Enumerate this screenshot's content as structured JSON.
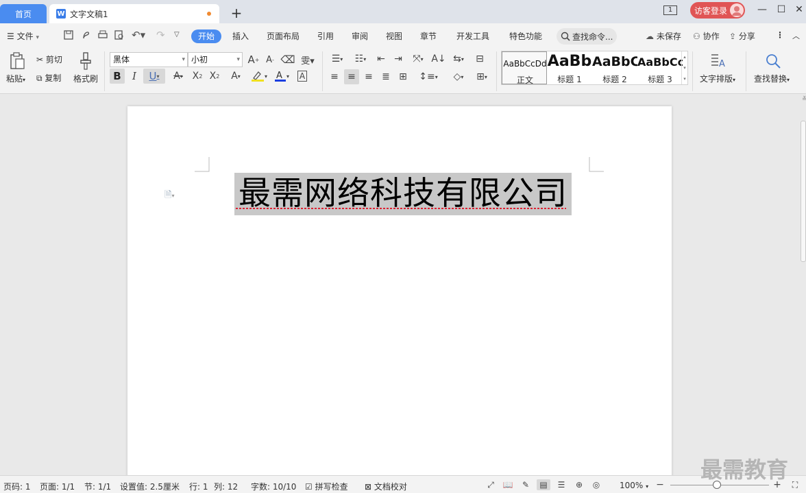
{
  "tabs": {
    "home": "首页",
    "doc": "文字文稿1",
    "doc_logo": "W"
  },
  "titlebar": {
    "page_count": "1",
    "login": "访客登录"
  },
  "menu": {
    "file": "文件",
    "items": [
      "开始",
      "插入",
      "页面布局",
      "引用",
      "审阅",
      "视图",
      "章节",
      "开发工具",
      "特色功能"
    ],
    "search": "查找命令...",
    "unsaved": "未保存",
    "collab": "协作",
    "share": "分享"
  },
  "ribbon": {
    "paste": "粘贴",
    "cut": "剪切",
    "copy": "复制",
    "format_painter": "格式刷",
    "font_name": "黑体",
    "font_size": "小初",
    "bold": "B",
    "italic": "I",
    "underline": "U",
    "styles": [
      {
        "sample": "AaBbCcDd",
        "name": "正文"
      },
      {
        "sample": "AaBb",
        "name": "标题 1"
      },
      {
        "sample": "AaBbC",
        "name": "标题 2"
      },
      {
        "sample": "AaBbCc",
        "name": "标题 3"
      }
    ],
    "text_layout": "文字排版",
    "find_replace": "查找替换"
  },
  "document": {
    "title": "最需网络科技有限公司"
  },
  "status": {
    "page_no": "页码: 1",
    "pages": "页面: 1/1",
    "section": "节: 1/1",
    "setting": "设置值: 2.5厘米",
    "row": "行: 1",
    "col": "列: 12",
    "words": "字数: 10/10",
    "spell": "拼写检查",
    "proof": "文档校对",
    "zoom": "100%",
    "zoom_level": 0.47
  },
  "watermark": "最需教育",
  "colors": {
    "accent": "#4a8cf0",
    "login": "#e05555",
    "selection": "#c8c8c8"
  }
}
